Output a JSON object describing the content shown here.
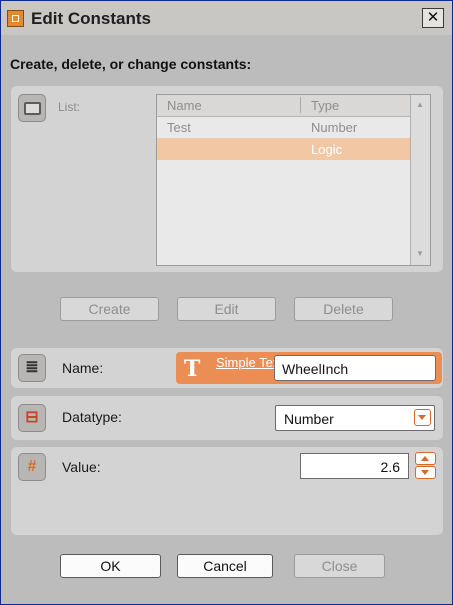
{
  "window": {
    "title": "Edit Constants",
    "close_glyph": "✕"
  },
  "heading": "Create, delete, or change constants:",
  "list": {
    "label": "List:",
    "columns": [
      "Name",
      "Type"
    ],
    "rows": [
      {
        "name": "Test",
        "type": "Number",
        "selected": false
      },
      {
        "name": "",
        "type": "Logic",
        "selected": true
      }
    ]
  },
  "actions": {
    "create": "Create",
    "edit": "Edit",
    "delete": "Delete"
  },
  "name_field": {
    "label": "Name:",
    "mode_link": "Simple Text",
    "value": "WheelInch"
  },
  "datatype_field": {
    "label": "Datatype:",
    "selected": "Number"
  },
  "value_field": {
    "label": "Value:",
    "value": "2.6"
  },
  "footer": {
    "ok": "OK",
    "cancel": "Cancel",
    "close": "Close"
  },
  "icons": {
    "title": "mindstorms-app-icon",
    "list": "folder-icon",
    "name": "text-field-icon",
    "datatype": "datatype-plug-icon",
    "value": "hash-icon"
  },
  "colors": {
    "accent": "#eb8e55",
    "selected_row": "#f2c8a4",
    "title_border": "#0a2c8a"
  }
}
